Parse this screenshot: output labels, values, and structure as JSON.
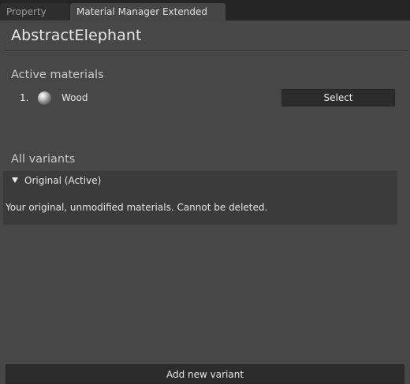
{
  "tabs": [
    {
      "label": "Property"
    },
    {
      "label": "Material Manager Extended"
    }
  ],
  "object_name": "AbstractElephant",
  "active_materials": {
    "heading": "Active materials",
    "items": [
      {
        "index": "1.",
        "name": "Wood",
        "icon": "material-sphere-icon",
        "button_label": "Select"
      }
    ]
  },
  "all_variants": {
    "heading": "All variants",
    "variants": [
      {
        "label": "Original (Active)",
        "description": "Your original, unmodified materials. Cannot be deleted.",
        "expanded": true
      }
    ]
  },
  "add_variant_label": "Add new variant"
}
